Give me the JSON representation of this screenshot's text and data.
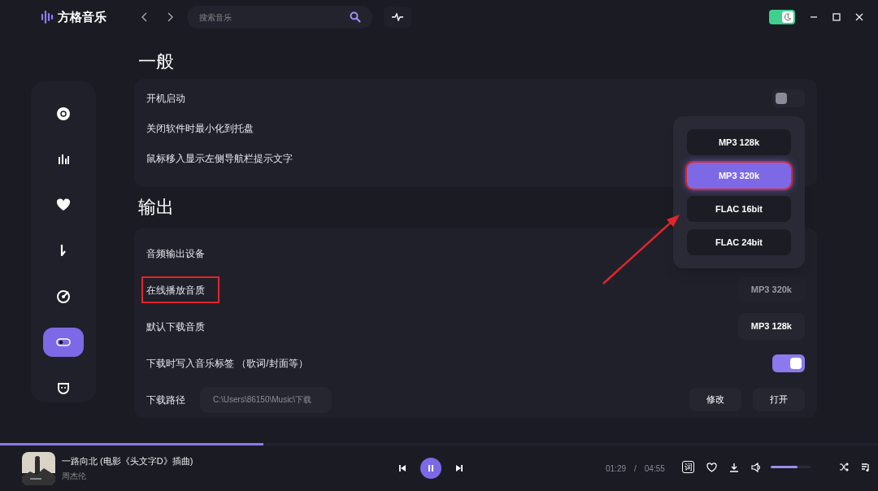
{
  "app": {
    "name": "方格音乐"
  },
  "search": {
    "placeholder": "搜索音乐"
  },
  "theme_toggle": {
    "on": true
  },
  "nav": [
    {
      "selected": false
    },
    {
      "selected": false
    },
    {
      "selected": false
    },
    {
      "selected": false
    },
    {
      "selected": false
    },
    {
      "selected": true
    },
    {
      "selected": false
    }
  ],
  "sections": [
    {
      "title": "一般",
      "rows": [
        {
          "label": "开机启动",
          "kind": "switch",
          "on": false
        },
        {
          "label": "关闭软件时最小化到托盘",
          "kind": "plain"
        },
        {
          "label": "鼠标移入显示左侧导航栏提示文字",
          "kind": "plain"
        }
      ]
    },
    {
      "title": "输出",
      "rows": [
        {
          "label": "音频输出设备",
          "kind": "plain"
        },
        {
          "label": "在线播放音质",
          "kind": "select",
          "value": "MP3 320k",
          "open": true,
          "highlighted": true
        },
        {
          "label": "默认下载音质",
          "kind": "select",
          "value": "MP3 128k",
          "open": false
        },
        {
          "label": "下载时写入音乐标签 （歌词/封面等）",
          "kind": "switch",
          "on": true
        },
        {
          "label": "下载路径",
          "kind": "path",
          "value": "C:\\Users\\86150\\Music\\下载",
          "buttons": [
            "修改",
            "打开"
          ]
        }
      ]
    }
  ],
  "dropdown": {
    "options": [
      {
        "label": "MP3 128k",
        "selected": false,
        "highlighted": false
      },
      {
        "label": "MP3 320k",
        "selected": true,
        "highlighted": true
      },
      {
        "label": "FLAC 16bit",
        "selected": false,
        "highlighted": false
      },
      {
        "label": "FLAC 24bit",
        "selected": false,
        "highlighted": false
      }
    ],
    "annotation_arrow": true
  },
  "player": {
    "title": "一路向北 (电影《头文字D》插曲)",
    "artist": "周杰伦",
    "playing": true,
    "progress": {
      "level": 0.3
    },
    "elapsed": "01:29",
    "separator": "/",
    "duration": "04:55",
    "lyrics_button": "词",
    "volume": {
      "level": 0.65
    }
  }
}
